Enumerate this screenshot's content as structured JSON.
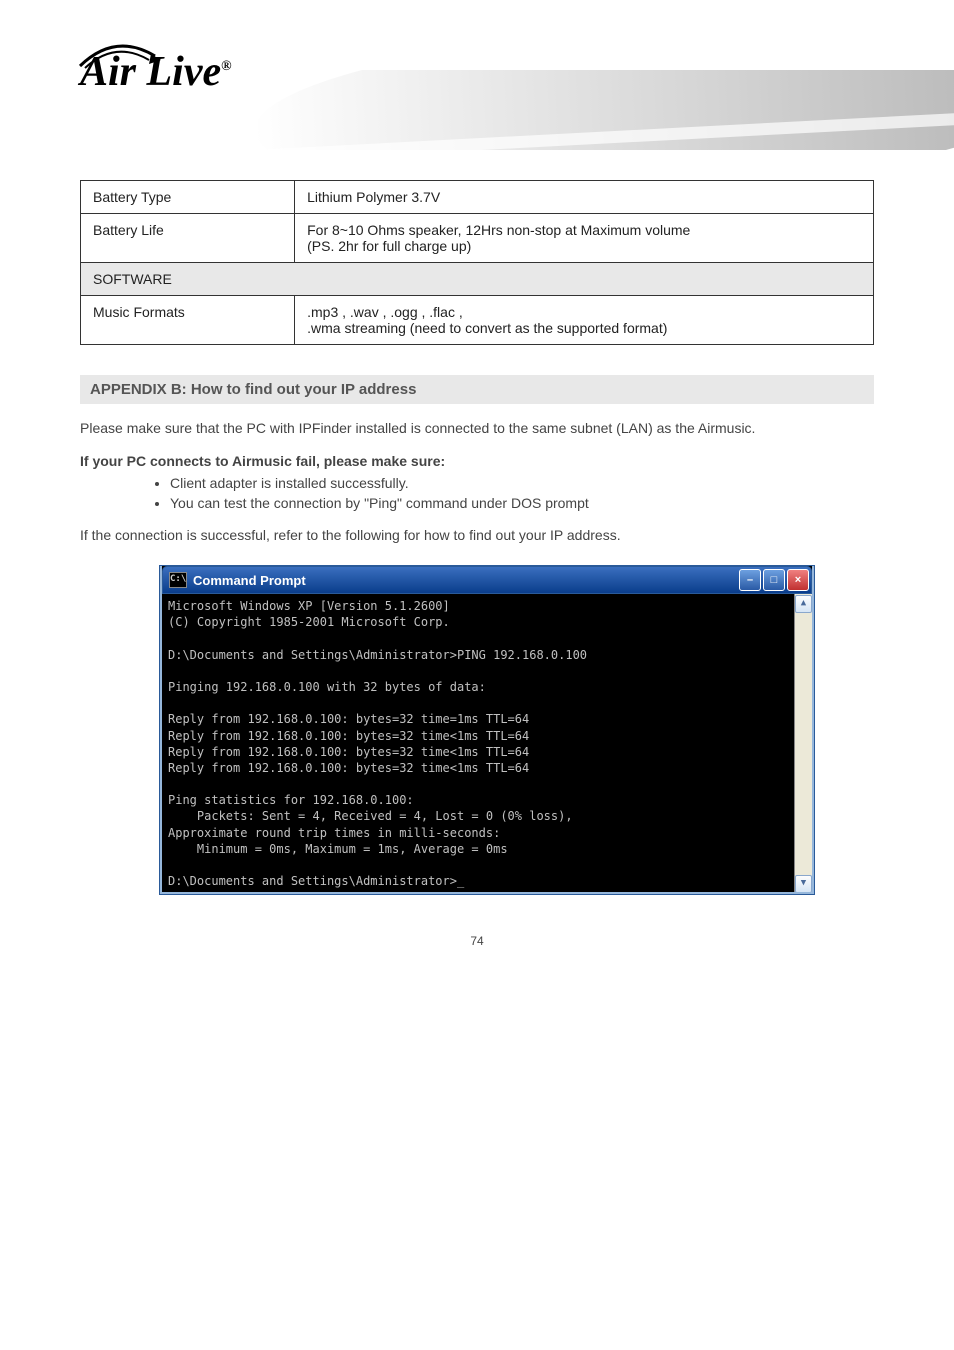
{
  "logo": {
    "text": "Air Live",
    "reg": "®"
  },
  "table": {
    "rows": [
      {
        "c1": "Battery Type",
        "c2": "Lithium Polymer 3.7V"
      },
      {
        "c1": "Battery Life",
        "c2": "For 8~10 Ohms speaker, 12Hrs non-stop at Maximum volume\n(PS. 2hr for full charge up)"
      },
      {
        "c1": "SOFTWARE",
        "c2": "",
        "shaded": true,
        "span": true
      },
      {
        "c1": "Music Formats",
        "c2": ".mp3 , .wav , .ogg , .flac ,\n.wma streaming (need to convert as the supported format)"
      }
    ]
  },
  "appendix": {
    "heading": "APPENDIX B: How to find out your IP address",
    "para1": "Please make sure that the PC with IPFinder installed is connected to the same subnet (LAN) as the Airmusic.",
    "para2": "If your PC connects to Airmusic fail, please make sure:",
    "bullets": [
      "Client adapter is installed successfully.",
      "You can test the connection by \"Ping\" command under DOS prompt"
    ],
    "para3": "If the connection is successful, refer to the following for how to find out your IP address."
  },
  "cmd": {
    "title": "Command Prompt",
    "icon_label": "C:\\",
    "lines": [
      "Microsoft Windows XP [Version 5.1.2600]",
      "(C) Copyright 1985-2001 Microsoft Corp.",
      "",
      "D:\\Documents and Settings\\Administrator>PING 192.168.0.100",
      "",
      "Pinging 192.168.0.100 with 32 bytes of data:",
      "",
      "Reply from 192.168.0.100: bytes=32 time=1ms TTL=64",
      "Reply from 192.168.0.100: bytes=32 time<1ms TTL=64",
      "Reply from 192.168.0.100: bytes=32 time<1ms TTL=64",
      "Reply from 192.168.0.100: bytes=32 time<1ms TTL=64",
      "",
      "Ping statistics for 192.168.0.100:",
      "    Packets: Sent = 4, Received = 4, Lost = 0 (0% loss),",
      "Approximate round trip times in milli-seconds:",
      "    Minimum = 0ms, Maximum = 1ms, Average = 0ms",
      "",
      "D:\\Documents and Settings\\Administrator>_"
    ]
  },
  "pagenum": "74"
}
